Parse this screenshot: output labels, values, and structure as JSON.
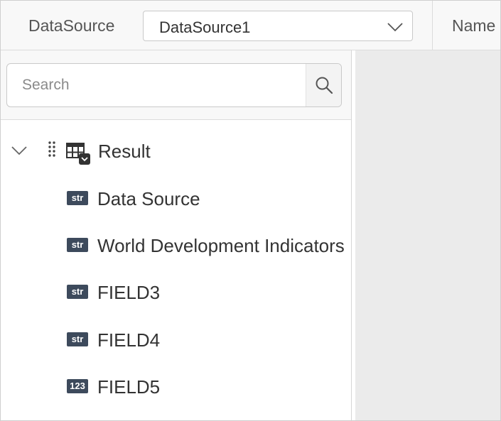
{
  "toolbar": {
    "datasource_label": "DataSource",
    "datasource_value": "DataSource1",
    "name_label": "Name"
  },
  "search": {
    "placeholder": "Search",
    "value": ""
  },
  "tree": {
    "root": {
      "label": "Result",
      "icon": "table-icon",
      "expanded": true
    },
    "fields": [
      {
        "type": "str",
        "label": "Data Source"
      },
      {
        "type": "str",
        "label": "World Development Indicators"
      },
      {
        "type": "str",
        "label": "FIELD3"
      },
      {
        "type": "str",
        "label": "FIELD4"
      },
      {
        "type": "123",
        "label": "FIELD5"
      }
    ]
  },
  "colors": {
    "badge": "#3d4a5c",
    "toolbar_bg": "#f8f8f8",
    "canvas_bg": "#ebebeb"
  }
}
